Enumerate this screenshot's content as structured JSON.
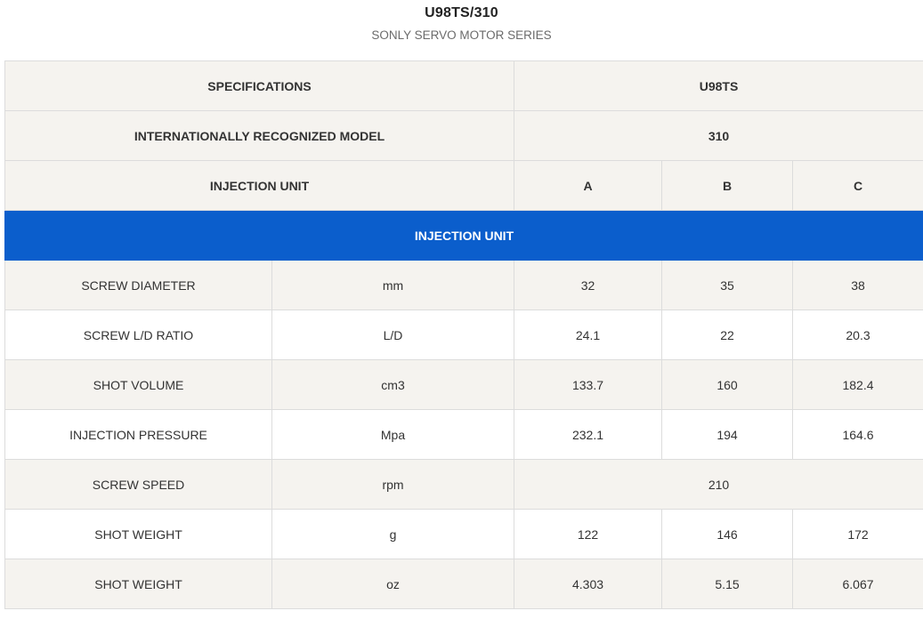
{
  "header": {
    "title": "U98TS/310",
    "subtitle": "SONLY SERVO MOTOR SERIES"
  },
  "table": {
    "specifications_label": "SPECIFICATIONS",
    "specifications_value": "U98TS",
    "model_label": "INTERNATIONALLY RECOGNIZED MODEL",
    "model_value": "310",
    "unit_label": "INJECTION UNIT",
    "unit_columns": [
      "A",
      "B",
      "C"
    ],
    "section_band": "INJECTION UNIT",
    "rows": [
      {
        "name": "SCREW DIAMETER",
        "unit": "mm",
        "a": "32",
        "b": "35",
        "c": "38"
      },
      {
        "name": "SCREW L/D RATIO",
        "unit": "L/D",
        "a": "24.1",
        "b": "22",
        "c": "20.3"
      },
      {
        "name": "SHOT VOLUME",
        "unit": "cm3",
        "a": "133.7",
        "b": "160",
        "c": "182.4"
      },
      {
        "name": "INJECTION PRESSURE",
        "unit": "Mpa",
        "a": "232.1",
        "b": "194",
        "c": "164.6"
      },
      {
        "name": "SCREW SPEED",
        "unit": "rpm",
        "merged": "210"
      },
      {
        "name": "SHOT WEIGHT",
        "unit": "g",
        "a": "122",
        "b": "146",
        "c": "172"
      },
      {
        "name": "SHOT WEIGHT",
        "unit": "oz",
        "a": "4.303",
        "b": "5.15",
        "c": "6.067"
      }
    ]
  }
}
